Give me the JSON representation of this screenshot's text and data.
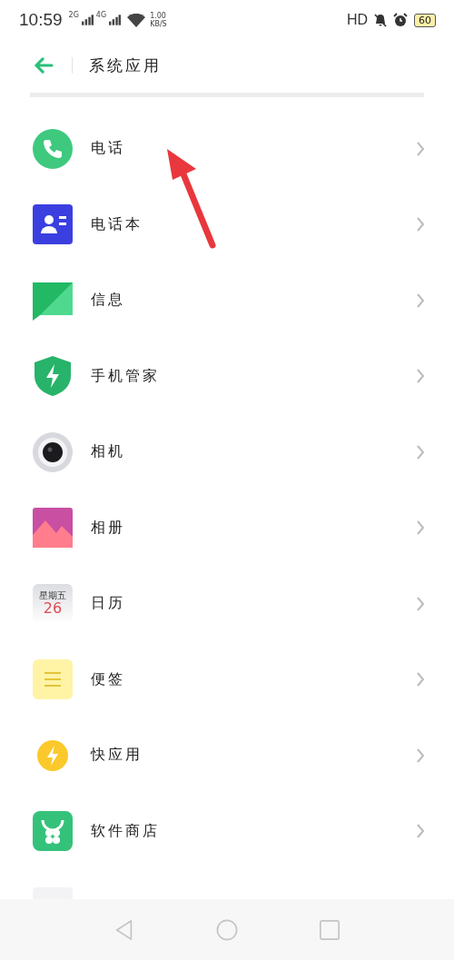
{
  "status_bar": {
    "time": "10:59",
    "sim1": "2G",
    "sim2": "4G",
    "speed_value": "1.00",
    "speed_unit": "KB/S",
    "hd": "HD",
    "battery": "60"
  },
  "header": {
    "title": "系统应用"
  },
  "apps": [
    {
      "kind": "phone",
      "name": "电话"
    },
    {
      "kind": "contacts",
      "name": "电话本"
    },
    {
      "kind": "messages",
      "name": "信息"
    },
    {
      "kind": "security",
      "name": "手机管家"
    },
    {
      "kind": "camera",
      "name": "相机"
    },
    {
      "kind": "gallery",
      "name": "相册"
    },
    {
      "kind": "calendar",
      "name": "日历",
      "weekday": "星期五",
      "day": "26"
    },
    {
      "kind": "notes",
      "name": "便签"
    },
    {
      "kind": "quickapp",
      "name": "快应用"
    },
    {
      "kind": "store",
      "name": "软件商店"
    },
    {
      "kind": "partial"
    }
  ]
}
